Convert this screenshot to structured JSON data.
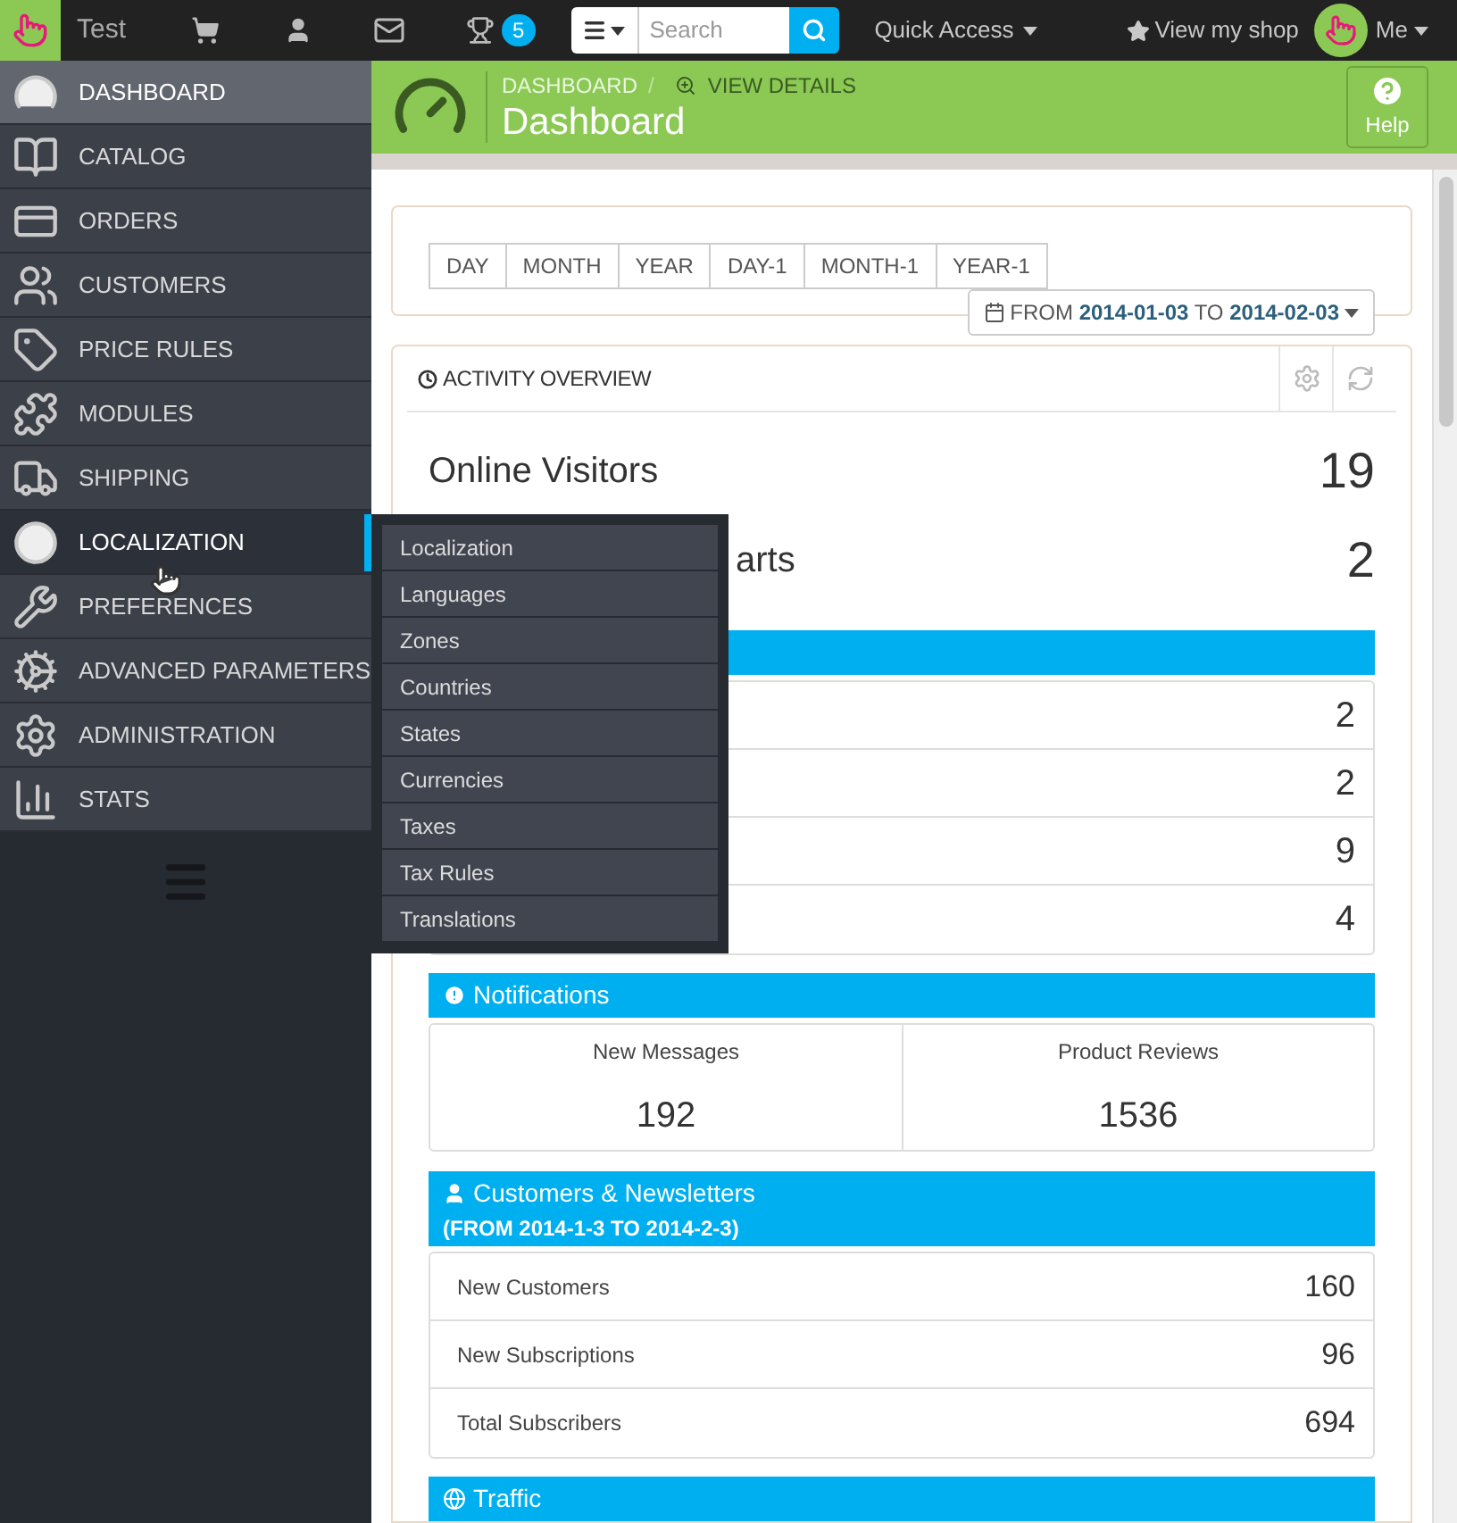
{
  "topbar": {
    "shop_name": "Test",
    "badge": "5",
    "search_placeholder": "Search",
    "quick_access": "Quick Access",
    "view_shop": "View my shop",
    "user": "Me"
  },
  "sidebar": {
    "items": [
      {
        "label": "DASHBOARD",
        "selected": true,
        "expanded": false
      },
      {
        "label": "CATALOG",
        "selected": false,
        "expanded": false
      },
      {
        "label": "ORDERS",
        "selected": false,
        "expanded": false
      },
      {
        "label": "CUSTOMERS",
        "selected": false,
        "expanded": false
      },
      {
        "label": "PRICE RULES",
        "selected": false,
        "expanded": false
      },
      {
        "label": "MODULES",
        "selected": false,
        "expanded": false
      },
      {
        "label": "SHIPPING",
        "selected": false,
        "expanded": false
      },
      {
        "label": "LOCALIZATION",
        "selected": false,
        "expanded": true
      },
      {
        "label": "PREFERENCES",
        "selected": false,
        "expanded": false
      },
      {
        "label": "ADVANCED PARAMETERS",
        "selected": false,
        "expanded": false
      },
      {
        "label": "ADMINISTRATION",
        "selected": false,
        "expanded": false
      },
      {
        "label": "STATS",
        "selected": false,
        "expanded": false
      }
    ]
  },
  "submenu": {
    "items": [
      "Localization",
      "Languages",
      "Zones",
      "Countries",
      "States",
      "Currencies",
      "Taxes",
      "Tax Rules",
      "Translations"
    ]
  },
  "header": {
    "breadcrumb": "DASHBOARD",
    "separator": "/",
    "view_details": "VIEW DETAILS",
    "title": "Dashboard",
    "help": "Help"
  },
  "date_buttons": [
    "DAY",
    "MONTH",
    "YEAR",
    "DAY-1",
    "MONTH-1",
    "YEAR-1"
  ],
  "date_range": "FROM **2014-01-03** TO **2014-02-03**",
  "activity": {
    "title": "ACTIVITY OVERVIEW",
    "metrics": [
      {
        "label": "Online Visitors",
        "value": "19"
      },
      {
        "label": "arts",
        "value": "2"
      }
    ],
    "list_values": [
      "2",
      "2",
      "9",
      "4"
    ],
    "notifications": {
      "title": "Notifications",
      "cells": [
        {
          "label": "New Messages",
          "value": "192"
        },
        {
          "label": "Product Reviews",
          "value": "1536"
        }
      ]
    },
    "customers": {
      "title": "Customers & Newsletters",
      "subtitle": "(FROM 2014-1-3 TO 2014-2-3)",
      "rows": [
        {
          "label": "New Customers",
          "value": "160"
        },
        {
          "label": "New Subscriptions",
          "value": "96"
        },
        {
          "label": "Total Subscribers",
          "value": "694"
        }
      ]
    },
    "traffic": {
      "title": "Traffic"
    }
  }
}
